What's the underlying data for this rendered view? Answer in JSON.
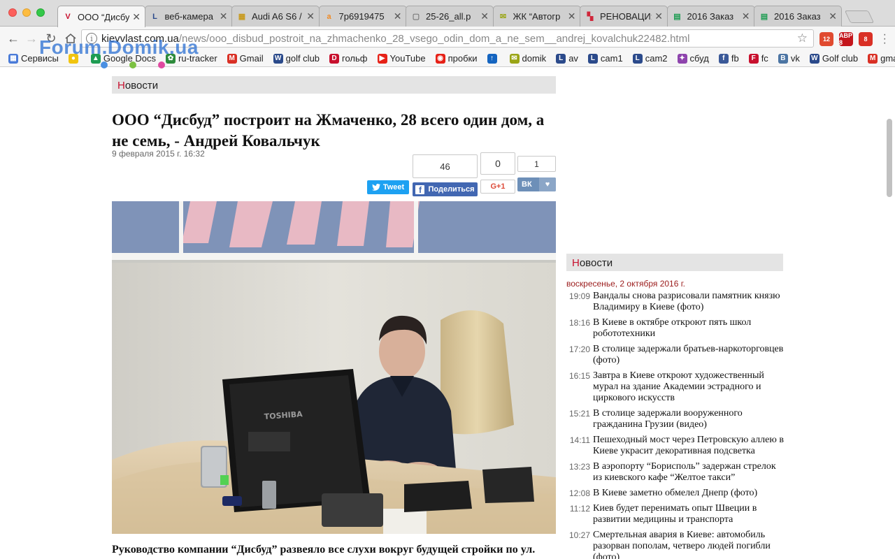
{
  "tabs": [
    {
      "label": "ООО “Дисбуд”",
      "fav_glyph": "V",
      "fav_color": "#c8102e",
      "active": true
    },
    {
      "label": "веб-камера",
      "fav_glyph": "L",
      "fav_color": "#2b4a8b",
      "active": false
    },
    {
      "label": "Audi A6 S6 /",
      "fav_glyph": "▦",
      "fav_color": "#c89a1e",
      "active": false
    },
    {
      "label": "7p6919475",
      "fav_glyph": "a",
      "fav_color": "#f08a24",
      "active": false
    },
    {
      "label": "25-26_all.p",
      "fav_glyph": "▢",
      "fav_color": "#777777",
      "active": false
    },
    {
      "label": "ЖК “Автогр",
      "fav_glyph": "✉",
      "fav_color": "#9aa516",
      "active": false
    },
    {
      "label": "РЕНОВАЦИЯ",
      "fav_glyph": "▚",
      "fav_color": "#d0263a",
      "active": false
    },
    {
      "label": "2016 Заказ",
      "fav_glyph": "▤",
      "fav_color": "#1e9c53",
      "active": false
    },
    {
      "label": "2016 Заказ",
      "fav_glyph": "▤",
      "fav_color": "#1e9c53",
      "active": false
    }
  ],
  "address": {
    "host": "kievvlast.com.ua",
    "path": "/news/ooo_disbud_postroit_na_zhmachenko_28_vsego_odin_dom_a_ne_sem__andrej_kovalchuk22482.html"
  },
  "extensions": [
    {
      "name": "calendar",
      "badge": "12",
      "color": "#e04a2f"
    },
    {
      "name": "adblock",
      "badge": "ABP 8",
      "color": "#c4161c"
    },
    {
      "name": "notifier",
      "badge": "8",
      "color": "#d93025"
    }
  ],
  "bookmarks": [
    {
      "label": "Сервисы",
      "icon": "▦",
      "color": "#4a7bd8"
    },
    {
      "label": "",
      "icon": "●",
      "color": "#f1c40f"
    },
    {
      "label": "Google Docs",
      "icon": "▲",
      "color": "#1e9c53"
    },
    {
      "label": "ru-tracker",
      "icon": "✿",
      "color": "#2e8b3c"
    },
    {
      "label": "Gmail",
      "icon": "M",
      "color": "#d93025"
    },
    {
      "label": "golf club",
      "icon": "W",
      "color": "#2b4a8b"
    },
    {
      "label": "гольф",
      "icon": "D",
      "color": "#c8102e"
    },
    {
      "label": "YouTube",
      "icon": "▶",
      "color": "#e62117"
    },
    {
      "label": "пробки",
      "icon": "◉",
      "color": "#e62117"
    },
    {
      "label": "",
      "icon": "↑",
      "color": "#1565c0"
    },
    {
      "label": "domik",
      "icon": "✉",
      "color": "#9aa516"
    },
    {
      "label": "av",
      "icon": "L",
      "color": "#2b4a8b"
    },
    {
      "label": "cam1",
      "icon": "L",
      "color": "#2b4a8b"
    },
    {
      "label": "cam2",
      "icon": "L",
      "color": "#2b4a8b"
    },
    {
      "label": "сбуд",
      "icon": "✦",
      "color": "#8e44ad"
    },
    {
      "label": "fb",
      "icon": "f",
      "color": "#3b5998"
    },
    {
      "label": "fc",
      "icon": "F",
      "color": "#c8102e"
    },
    {
      "label": "vk",
      "icon": "B",
      "color": "#4c75a3"
    },
    {
      "label": "Golf club",
      "icon": "W",
      "color": "#2b4a8b"
    },
    {
      "label": "gmail",
      "icon": "M",
      "color": "#d93025"
    }
  ],
  "watermark": "Forum.Domik.ua",
  "section": {
    "first_letter": "Н",
    "rest": "овости"
  },
  "sidebar_section": {
    "first_letter": "Н",
    "rest": "овости"
  },
  "article": {
    "title": "ООО “Дисбуд” построит на Жмаченко, 28 всего один дом, а не семь, - Андрей Ковальчук",
    "date": "9 февраля 2015 г. 16:32",
    "lead": "Руководство компании “Дисбуд” развеяло все слухи вокруг будущей стройки по ул."
  },
  "share": {
    "tweet_label": "Tweet",
    "fb_label": "Поделиться",
    "fb_count": "46",
    "gplus_label": "G+1",
    "gplus_count": "0",
    "vk_label": "ВК",
    "vk_count": "1"
  },
  "photo": {
    "monitor_brand": "TOSHIBA"
  },
  "sidebar": {
    "date": "воскресенье, 2 октября 2016 г.",
    "news": [
      {
        "time": "19:09",
        "title": "Вандалы снова разрисовали памятник князю Владимиру в Киеве (фото)"
      },
      {
        "time": "18:16",
        "title": "В Киеве в октябре откроют пять школ робототехники"
      },
      {
        "time": "17:20",
        "title": "В столице задержали братьев-наркоторговцев (фото)"
      },
      {
        "time": "16:15",
        "title": "Завтра в Киеве откроют художественный мурал на здание Академии эстрадного и циркового искусств"
      },
      {
        "time": "15:21",
        "title": "В столице задержали вооруженного гражданина Грузии (видео)"
      },
      {
        "time": "14:11",
        "title": "Пешеходный мост через Петровскую аллею в Киеве украсит декоративная подсветка"
      },
      {
        "time": "13:23",
        "title": "В аэропорту “Борисполь” задержан стрелок из киевского кафе “Желтое такси”"
      },
      {
        "time": "12:08",
        "title": "В Киеве заметно обмелел Днепр (фото)"
      },
      {
        "time": "11:12",
        "title": "Киев будет перенимать опыт Швеции в развитии медицины и транспорта"
      },
      {
        "time": "10:27",
        "title": "Смертельная авария в Киеве: автомобиль разорван пополам, четверо людей погибли (фото)"
      }
    ]
  }
}
